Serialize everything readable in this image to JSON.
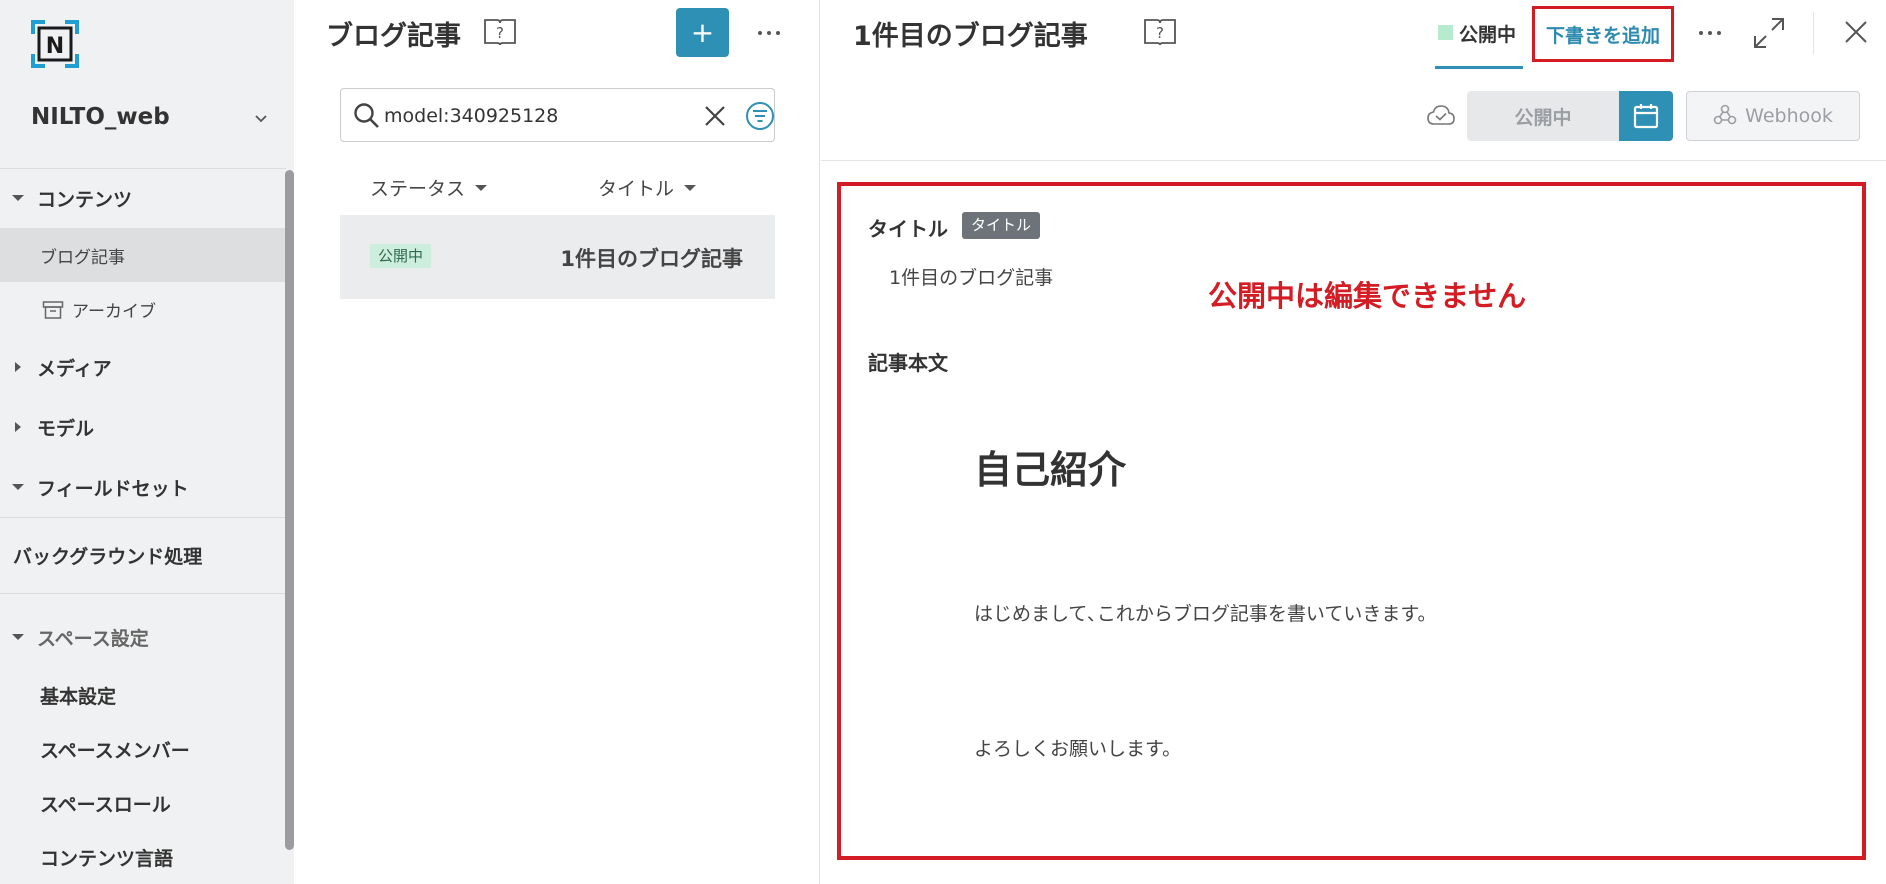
{
  "sidebar": {
    "logo_letter": "N",
    "space_name": "NILTO_web",
    "sections": {
      "content": "コンテンツ",
      "blog": "ブログ記事",
      "archive": "アーカイブ",
      "media": "メディア",
      "model": "モデル",
      "fieldset": "フィールドセット",
      "background": "バックグラウンド処理",
      "space_settings": "スペース設定",
      "basic_settings": "基本設定",
      "space_members": "スペースメンバー",
      "space_roles": "スペースロール",
      "content_language": "コンテンツ言語"
    }
  },
  "list": {
    "title": "ブログ記事",
    "add_label": "+",
    "search_value": "model:340925128",
    "col_status": "ステータス",
    "col_title": "タイトル",
    "rows": [
      {
        "status": "公開中",
        "title": "1件目のブログ記事"
      }
    ]
  },
  "detail": {
    "title": "1件目のブログ記事",
    "tab_published": "公開中",
    "add_draft": "下書きを追加",
    "status_button": "公開中",
    "webhook_button": "Webhook",
    "field_title_label": "タイトル",
    "field_title_badge": "タイトル",
    "field_title_value": "1件目のブログ記事",
    "notice": "公開中は編集できません",
    "field_body_label": "記事本文",
    "body_heading": "自己紹介",
    "body_p1": "はじめまして､これからブログ記事を書いていきます。",
    "body_p2": "よろしくお願いします。"
  },
  "colors": {
    "accent": "#2e90b4",
    "highlight_red": "#d41c24",
    "published_green": "#b7ebd0"
  }
}
